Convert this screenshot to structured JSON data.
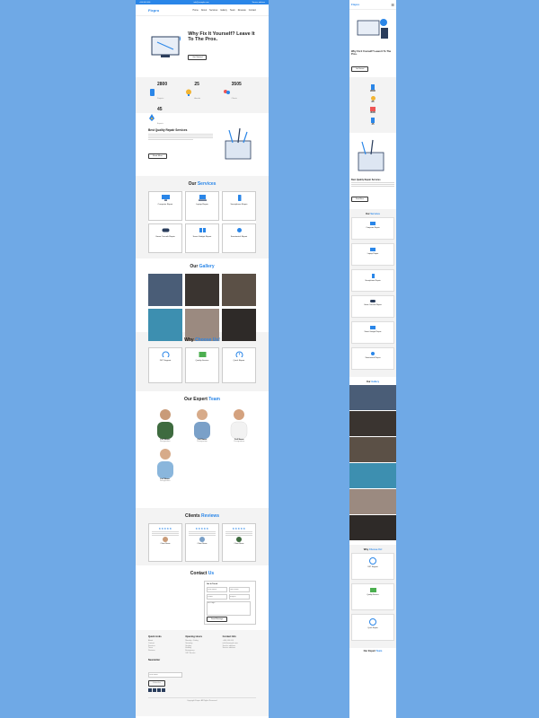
{
  "topbar": {
    "phone": "+000 000 000",
    "email": "info@example.com",
    "address": "Service address"
  },
  "nav": {
    "logo": "Fixpro",
    "links": [
      "Home",
      "About",
      "Services",
      "Gallery",
      "Team",
      "Reviews",
      "Contact"
    ]
  },
  "hero": {
    "title": "Why Fix It Yourself? Leave It To The Pros.",
    "button": "Get Started"
  },
  "stats": [
    {
      "value": "2800",
      "label": "Projects",
      "icon": "phone-icon"
    },
    {
      "value": "25",
      "label": "Awards",
      "icon": "award-icon"
    },
    {
      "value": "3505",
      "label": "Clients",
      "icon": "people-icon"
    },
    {
      "value": "45",
      "label": "Experts",
      "icon": "rocket-icon"
    }
  ],
  "quality": {
    "title": "Best Quality Repair Services",
    "button": "Read More"
  },
  "services": {
    "title_a": "Our ",
    "title_b": "Services",
    "items": [
      {
        "name": "Computer Repair",
        "icon": "monitor-icon"
      },
      {
        "name": "Laptop Repair",
        "icon": "laptop-icon"
      },
      {
        "name": "Smartphone Repair",
        "icon": "smartphone-icon"
      },
      {
        "name": "Game Console Repair",
        "icon": "gamepad-icon"
      },
      {
        "name": "Smart Gadget Repair",
        "icon": "gadget-icon"
      },
      {
        "name": "Smartwatch Repair",
        "icon": "watch-icon"
      }
    ]
  },
  "gallery": {
    "title_a": "Our ",
    "title_b": "Gallery"
  },
  "why": {
    "title_a": "Why ",
    "title_b": "Choose Us!",
    "items": [
      {
        "name": "24/7 Support",
        "icon": "headset-icon"
      },
      {
        "name": "Quality Service",
        "icon": "screen-check-icon"
      },
      {
        "name": "Quick Repair",
        "icon": "clock-icon"
      }
    ]
  },
  "team": {
    "title_a": "Our Expert ",
    "title_b": "Team",
    "members": [
      {
        "name": "Full Name",
        "role": "Designation"
      },
      {
        "name": "Full Name",
        "role": "Designation"
      },
      {
        "name": "Full Name",
        "role": "Designation"
      },
      {
        "name": "Full Name",
        "role": "Designation"
      }
    ]
  },
  "reviews": {
    "title_a": "Clients ",
    "title_b": "Reviews",
    "items": [
      {
        "stars": "★★★★★",
        "name": "Client Name"
      },
      {
        "stars": "★★★★★",
        "name": "Client Name"
      },
      {
        "stars": "★★★★★",
        "name": "Client Name"
      }
    ]
  },
  "contact": {
    "title_a": "Contact ",
    "title_b": "Us",
    "form_title": "Get In Touch",
    "name_ph": "Your Name",
    "email_ph": "Your Email",
    "phone_ph": "Phone",
    "subject_ph": "Subject",
    "message_ph": "Message",
    "button": "Send Message"
  },
  "footer": {
    "col1_title": "Quick Links",
    "col1": [
      "About",
      "Contact",
      "Services",
      "Team",
      "Reviews"
    ],
    "col2_title": "Opening Hours",
    "col2": [
      "Monday - Friday",
      "Saturday",
      "Sunday",
      "Holiday",
      "Emergency",
      "24/7 Service"
    ],
    "col3_title": "Contact Info",
    "col3": [
      "+000 000 000",
      "info@example.com",
      "Service address",
      "Service address"
    ],
    "news_title": "Newsletter",
    "news_ph": "Your Email",
    "news_btn": "Subscribe",
    "copyright": "Copyright Fixpro. All Rights Reserved."
  },
  "colors": {
    "accent": "#2a86e8",
    "page_bg": "#6fa9e6"
  }
}
